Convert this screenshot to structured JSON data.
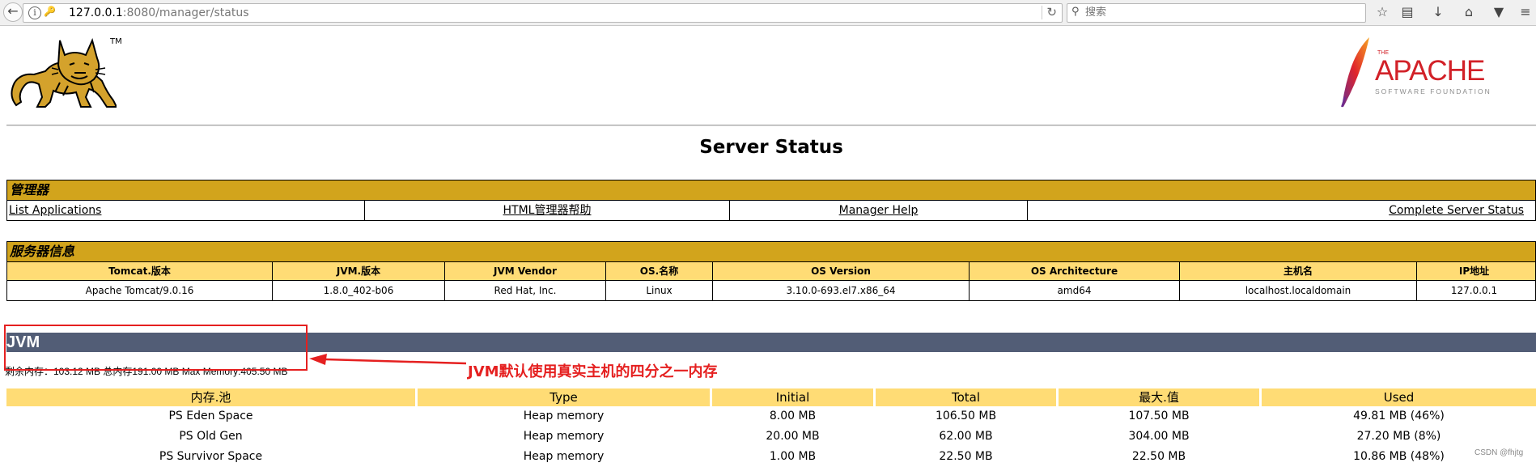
{
  "browser": {
    "url_host": "127.0.0.1",
    "url_rest": ":8080/manager/status",
    "search_placeholder": "搜索"
  },
  "logo": {
    "tm": "TM"
  },
  "apache": {
    "the": "THE",
    "name": "APACHE",
    "sub": "SOFTWARE FOUNDATION"
  },
  "page_title": "Server Status",
  "manager": {
    "heading": "管理器",
    "links": [
      "List Applications",
      "HTML管理器帮助",
      "Manager Help",
      "Complete Server Status"
    ]
  },
  "server_info": {
    "heading": "服务器信息",
    "headers": [
      "Tomcat.版本",
      "JVM.版本",
      "JVM Vendor",
      "OS.名称",
      "OS Version",
      "OS Architecture",
      "主机名",
      "IP地址"
    ],
    "values": [
      "Apache Tomcat/9.0.16",
      "1.8.0_402-b06",
      "Red Hat, Inc.",
      "Linux",
      "3.10.0-693.el7.x86_64",
      "amd64",
      "localhost.localdomain",
      "127.0.0.1"
    ]
  },
  "jvm": {
    "heading": "JVM",
    "memory_line": "剩余内存：103.12 MB 总内存191.00 MB Max Memory:405.50 MB",
    "annotation": "JVM默认使用真实主机的四分之一内存"
  },
  "memory_pools": {
    "headers": [
      "内存.池",
      "Type",
      "Initial",
      "Total",
      "最大.值",
      "Used"
    ],
    "rows": [
      [
        "PS Eden Space",
        "Heap memory",
        "8.00 MB",
        "106.50 MB",
        "107.50 MB",
        "49.81 MB (46%)"
      ],
      [
        "PS Old Gen",
        "Heap memory",
        "20.00 MB",
        "62.00 MB",
        "304.00 MB",
        "27.20 MB (8%)"
      ],
      [
        "PS Survivor Space",
        "Heap memory",
        "1.00 MB",
        "22.50 MB",
        "22.50 MB",
        "10.86 MB (48%)"
      ]
    ]
  },
  "watermark": "CSDN @fhjtg",
  "colors": {
    "section_header": "#d2a41c",
    "table_header": "#ffdc75",
    "jvm_bar": "#525d76",
    "annotation_red": "#e52020",
    "apache_red": "#d22128"
  }
}
